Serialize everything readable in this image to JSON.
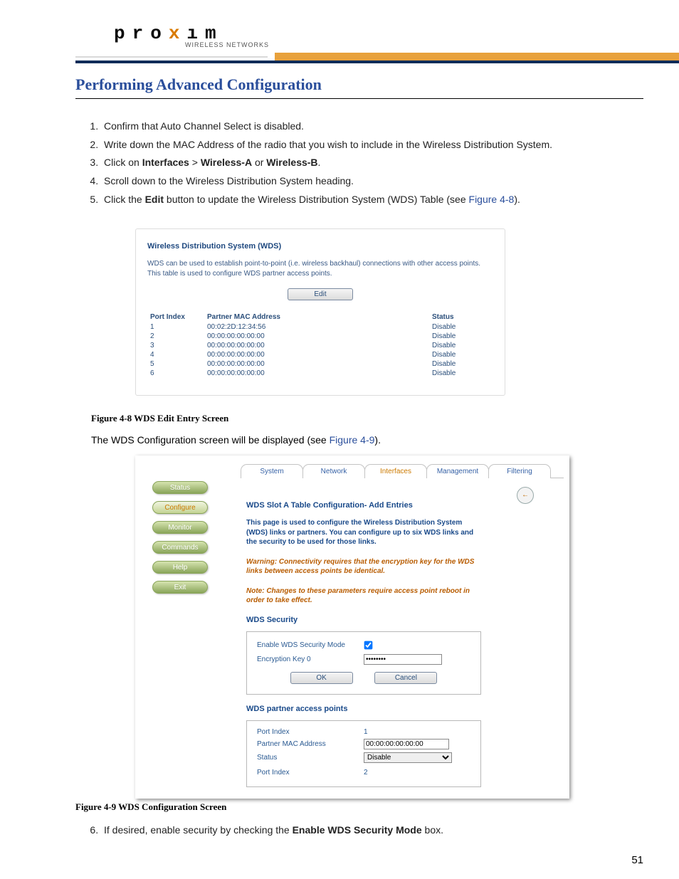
{
  "logo": {
    "brand_pre": "pro",
    "brand_x": "x",
    "brand_post": "ım",
    "sub": "WIRELESS NETWORKS"
  },
  "section_title": "Performing Advanced Configuration",
  "steps": {
    "1": "Confirm that Auto Channel Select is disabled.",
    "2": "Write down the MAC Address of the radio that you wish to include in the Wireless Distribution System.",
    "3_pre": "Click on ",
    "3_b1": "Interfaces",
    "3_mid": " > ",
    "3_b2": "Wireless-A",
    "3_or": " or ",
    "3_b3": "Wireless-B",
    "3_post": ".",
    "4": "Scroll down to the Wireless Distribution System heading.",
    "5_pre": "Click the ",
    "5_b": "Edit",
    "5_mid": " button to update the Wireless Distribution System (WDS) Table (see ",
    "5_link": "Figure 4-8",
    "5_post": ").",
    "6_pre": "If desired, enable security by checking the ",
    "6_b": "Enable WDS Security Mode",
    "6_post": " box."
  },
  "fig48": {
    "title": "Wireless Distribution System (WDS)",
    "desc": "WDS can be used to establish point-to-point (i.e. wireless backhaul) connections with other access points. This table is used to configure WDS partner access points.",
    "edit": "Edit",
    "headers": {
      "port": "Port Index",
      "mac": "Partner MAC Address",
      "status": "Status"
    },
    "rows": [
      {
        "port": "1",
        "mac": "00:02:2D:12:34:56",
        "status": "Disable"
      },
      {
        "port": "2",
        "mac": "00:00:00:00:00:00",
        "status": "Disable"
      },
      {
        "port": "3",
        "mac": "00:00:00:00:00:00",
        "status": "Disable"
      },
      {
        "port": "4",
        "mac": "00:00:00:00:00:00",
        "status": "Disable"
      },
      {
        "port": "5",
        "mac": "00:00:00:00:00:00",
        "status": "Disable"
      },
      {
        "port": "6",
        "mac": "00:00:00:00:00:00",
        "status": "Disable"
      }
    ],
    "caption": "Figure 4-8      WDS Edit Entry Screen"
  },
  "body1_pre": "The WDS Configuration screen will be displayed (see ",
  "body1_link": "Figure 4-9",
  "body1_post": ").",
  "fig49": {
    "tabs": [
      "System",
      "Network",
      "Interfaces",
      "Management",
      "Filtering"
    ],
    "active_tab_index": 2,
    "sidebar": [
      "Status",
      "Configure",
      "Monitor",
      "Commands",
      "Help",
      "Exit"
    ],
    "sidebar_sel_index": 1,
    "back_glyph": "←",
    "heading": "WDS Slot A Table Configuration- Add Entries",
    "intro": "This page is used to configure the Wireless Distribution System (WDS) links or partners. You can configure up to six WDS links and the security to be used for those links.",
    "warn": "Warning: Connectivity requires that the encryption key for the WDS links between access points be identical.",
    "note": "Note: Changes to these parameters require access point reboot in order to take effect.",
    "sec_h": "WDS Security",
    "enable_label": "Enable WDS Security Mode",
    "key_label": "Encryption Key 0",
    "key_value": "••••••••",
    "ok": "OK",
    "cancel": "Cancel",
    "pap_h": "WDS partner access points",
    "port_label": "Port Index",
    "mac_label": "Partner MAC Address",
    "status_label": "Status",
    "port1_value": "1",
    "mac1_value": "00:00:00:00:00:00",
    "status1_value": "Disable",
    "port2_value": "2",
    "caption": "Figure 4-9      WDS Configuration Screen"
  },
  "pagenum": "51"
}
